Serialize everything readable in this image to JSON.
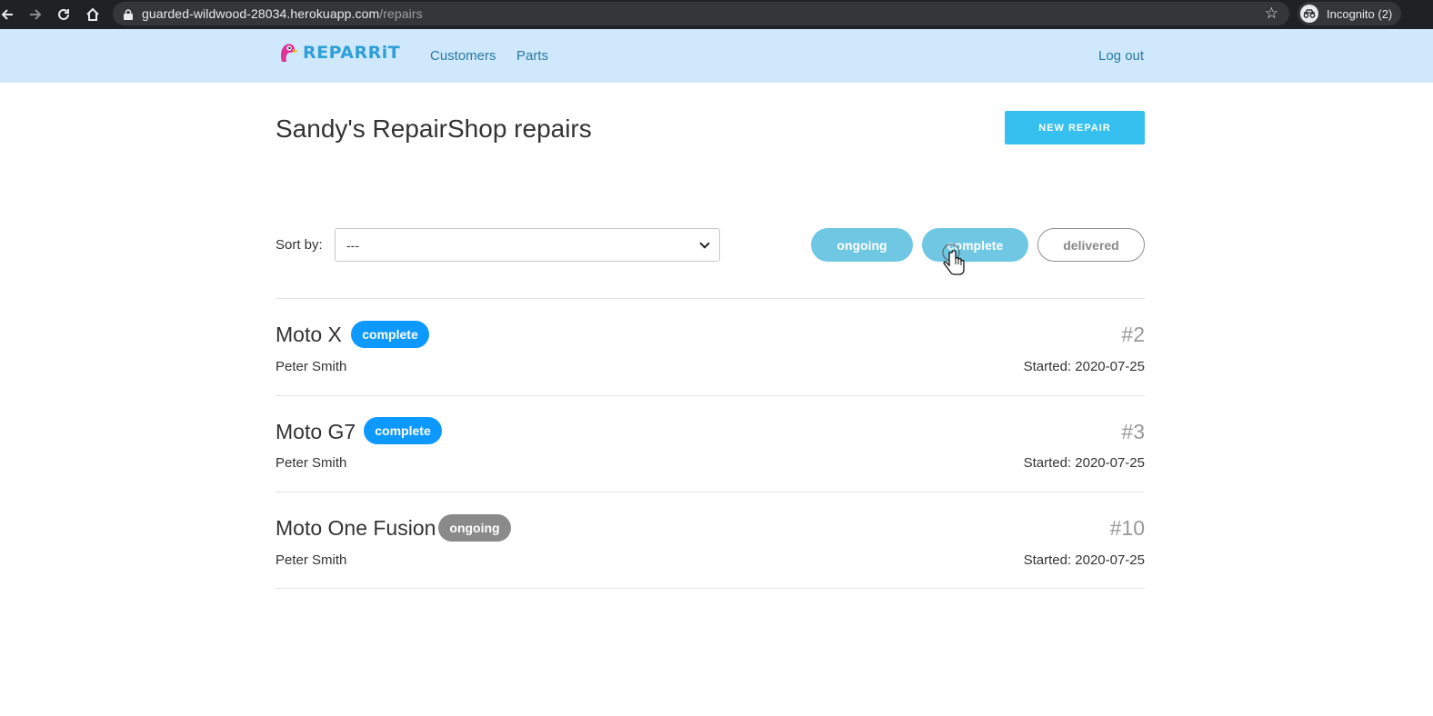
{
  "browser": {
    "url_host": "guarded-wildwood-28034.herokuapp.com",
    "url_path": "/repairs",
    "incognito_label": "Incognito (2)"
  },
  "header": {
    "logo_text": "REPARRiT",
    "nav": [
      "Customers",
      "Parts"
    ],
    "logout": "Log out"
  },
  "main": {
    "title": "Sandy's RepairShop repairs",
    "new_repair_label": "NEW REPAIR",
    "sort": {
      "label": "Sort by:",
      "value": "---"
    },
    "filters": [
      {
        "label": "ongoing",
        "state": "active"
      },
      {
        "label": "complete",
        "state": "active"
      },
      {
        "label": "delivered",
        "state": "inactive"
      }
    ]
  },
  "repairs": [
    {
      "name": "Moto X",
      "status": "complete",
      "number": "#2",
      "customer": "Peter Smith",
      "started": "Started: 2020-07-25"
    },
    {
      "name": "Moto G7",
      "status": "complete",
      "number": "#3",
      "customer": "Peter Smith",
      "started": "Started: 2020-07-25"
    },
    {
      "name": "Moto One Fusion",
      "status": "ongoing",
      "number": "#10",
      "customer": "Peter Smith",
      "started": "Started: 2020-07-25"
    }
  ],
  "colors": {
    "header_bg": "#cfe8fb",
    "accent": "#36c0ef",
    "badge_complete": "#0d99ff",
    "badge_ongoing": "#8a8a8a"
  }
}
